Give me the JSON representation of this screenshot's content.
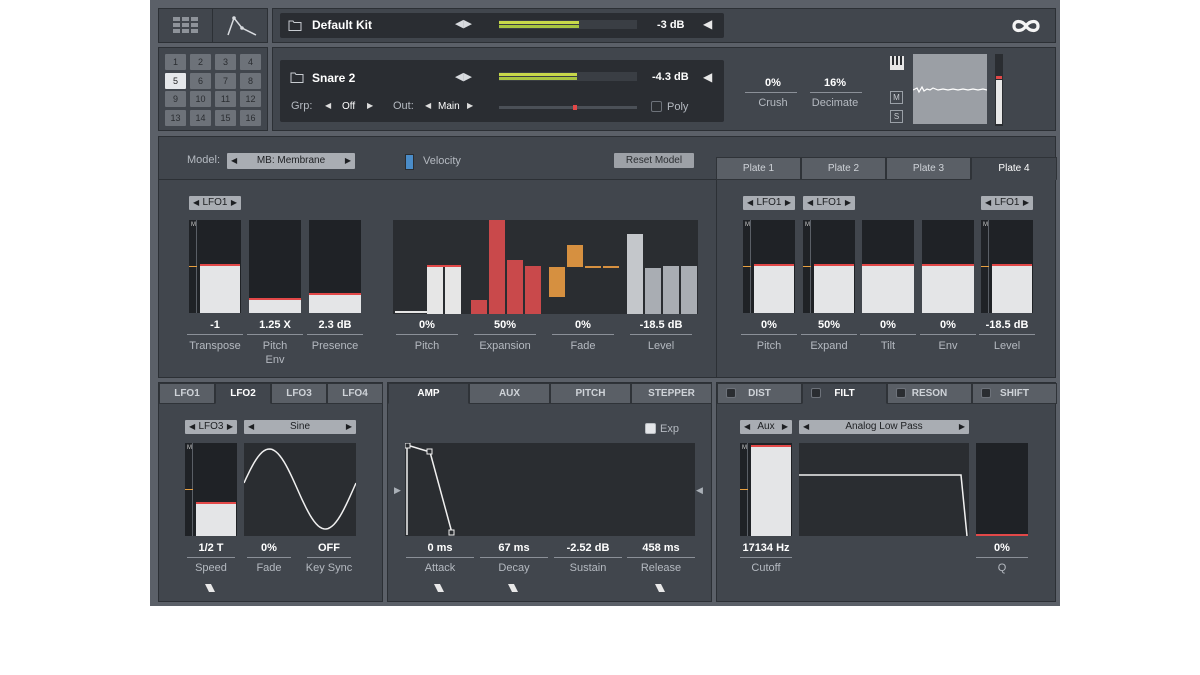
{
  "header": {
    "kit_name": "Default Kit",
    "kit_level": "-3 dB",
    "logo_icon": "infinity-logo-icon"
  },
  "pads": [
    "1",
    "2",
    "3",
    "4",
    "5",
    "6",
    "7",
    "8",
    "9",
    "10",
    "11",
    "12",
    "13",
    "14",
    "15",
    "16"
  ],
  "selected_pad": "5",
  "instrument": {
    "name": "Snare 2",
    "level": "-4.3 dB",
    "grp_label": "Grp:",
    "grp_value": "Off",
    "out_label": "Out:",
    "out_value": "Main",
    "poly_label": "Poly",
    "crush_value": "0%",
    "crush_label": "Crush",
    "decimate_value": "16%",
    "decimate_label": "Decimate",
    "m_label": "M",
    "s_label": "S"
  },
  "model": {
    "label": "Model:",
    "value": "MB: Membrane",
    "velocity_label": "Velocity",
    "reset_label": "Reset Model"
  },
  "plate_tabs": [
    "Plate 1",
    "Plate 2",
    "Plate 3",
    "Plate 4"
  ],
  "active_plate_tab": 3,
  "lfo_small": "LFO1",
  "m_tag": "M",
  "left_meters": [
    {
      "value": "-1",
      "label": "Transpose",
      "fill": 0.5
    },
    {
      "value": "1.25 X",
      "label": "Pitch",
      "label2": "Env",
      "fill": 0.14
    },
    {
      "value": "2.3 dB",
      "label": "Presence",
      "fill": 0.19
    }
  ],
  "bar_groups": [
    {
      "value": "0%",
      "label": "Pitch"
    },
    {
      "value": "50%",
      "label": "Expansion"
    },
    {
      "value": "0%",
      "label": "Fade"
    },
    {
      "value": "-18.5 dB",
      "label": "Level"
    }
  ],
  "right_meters": [
    {
      "value": "0%",
      "label": "Pitch",
      "lfo": true
    },
    {
      "value": "50%",
      "label": "Expand",
      "lfo": true
    },
    {
      "value": "0%",
      "label": "Tilt",
      "lfo": false
    },
    {
      "value": "0%",
      "label": "Env",
      "lfo": false
    },
    {
      "value": "-18.5 dB",
      "label": "Level",
      "lfo": true
    }
  ],
  "lfo_tabs": [
    "LFO1",
    "LFO2",
    "LFO3",
    "LFO4"
  ],
  "active_lfo_tab": 1,
  "lfo": {
    "source": "LFO3",
    "shape": "Sine",
    "speed_value": "1/2 T",
    "speed_label": "Speed",
    "fade_value": "0%",
    "fade_label": "Fade",
    "keysync_value": "OFF",
    "keysync_label": "Key Sync"
  },
  "env_tabs": [
    "AMP",
    "AUX",
    "PITCH",
    "STEPPER"
  ],
  "active_env_tab": 0,
  "env": {
    "exp_label": "Exp",
    "attack_value": "0 ms",
    "attack_label": "Attack",
    "decay_value": "67 ms",
    "decay_label": "Decay",
    "sustain_value": "-2.52 dB",
    "sustain_label": "Sustain",
    "release_value": "458 ms",
    "release_label": "Release"
  },
  "fx_tabs": [
    "DIST",
    "FILT",
    "RESON",
    "SHIFT"
  ],
  "active_fx_tab": 1,
  "filter": {
    "source": "Aux",
    "type": "Analog Low Pass",
    "cutoff_value": "17134 Hz",
    "cutoff_label": "Cutoff",
    "q_value": "0%",
    "q_label": "Q"
  }
}
